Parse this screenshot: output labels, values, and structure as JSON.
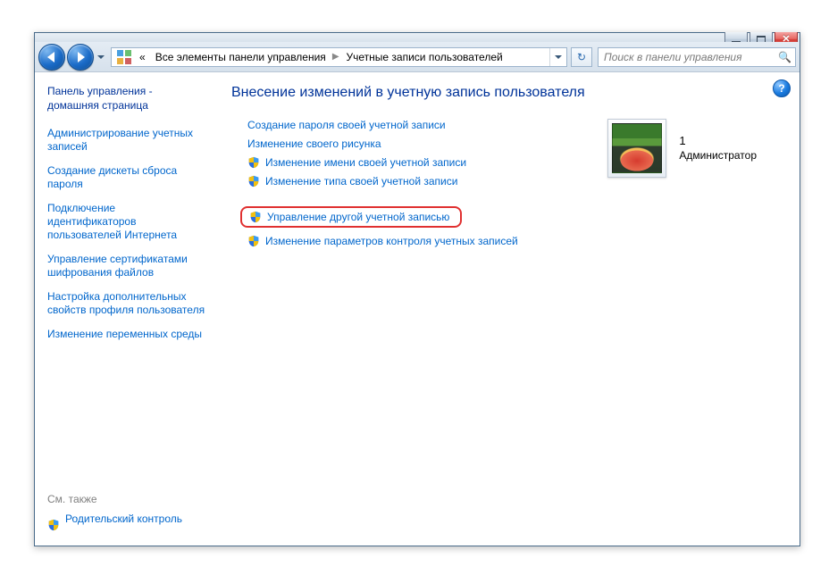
{
  "breadcrumb": {
    "segment1": "Все элементы панели управления",
    "segment2": "Учетные записи пользователей",
    "prefix": "«"
  },
  "search": {
    "placeholder": "Поиск в панели управления"
  },
  "sidebar": {
    "home": "Панель управления - домашняя страница",
    "links": [
      "Администрирование учетных записей",
      "Создание дискеты сброса пароля",
      "Подключение идентификаторов пользователей Интернета",
      "Управление сертификатами шифрования файлов",
      "Настройка дополнительных свойств профиля пользователя",
      "Изменение переменных среды"
    ],
    "see_also_label": "См. также",
    "see_also_link": "Родительский контроль"
  },
  "content": {
    "title": "Внесение изменений в учетную запись пользователя",
    "tasks_plain": [
      "Создание пароля своей учетной записи",
      "Изменение своего рисунка"
    ],
    "tasks_shield": [
      "Изменение имени своей учетной записи",
      "Изменение типа своей учетной записи"
    ],
    "task_highlighted": "Управление другой учетной записью",
    "task_after": "Изменение параметров контроля учетных записей"
  },
  "account": {
    "name": "1",
    "role": "Администратор"
  }
}
